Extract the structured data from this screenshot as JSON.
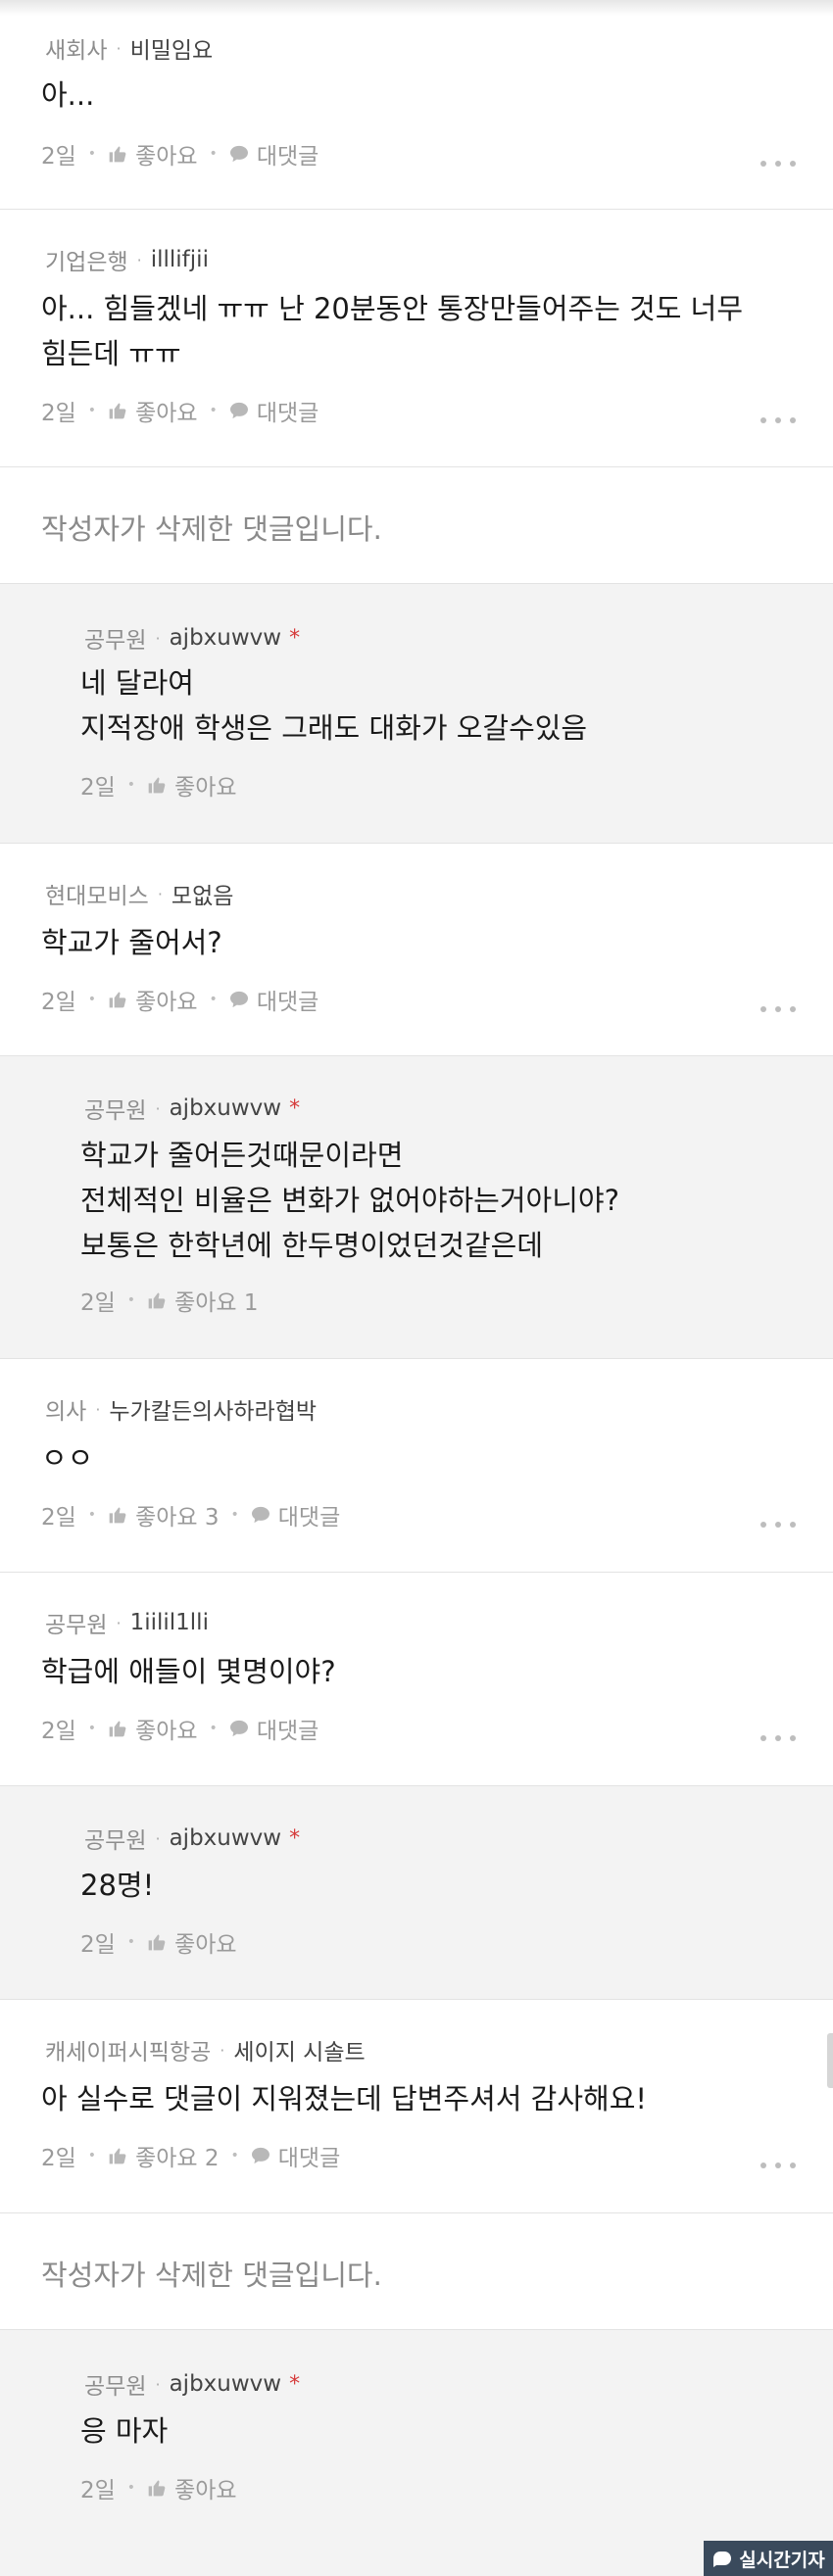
{
  "comments": [
    {
      "company": "새회사",
      "nick": "비밀임요",
      "lines": [
        "아..."
      ],
      "time": "2일",
      "like": "좋아요",
      "reply": "대댓글"
    },
    {
      "company": "기업은행",
      "nick": "illlifjii",
      "lines": [
        "아... 힘들겠네 ㅠㅠ 난 20분동안 통장만들어주는 것도 너무",
        "힘든데 ㅠㅠ"
      ],
      "time": "2일",
      "like": "좋아요",
      "reply": "대댓글"
    },
    {
      "deleted": "작성자가 삭제한 댓글입니다."
    },
    {
      "company": "공무원",
      "nick": "ajbxuwvw",
      "star": "*",
      "lines": [
        "네 달라여",
        "지적장애 학생은 그래도 대화가 오갈수있음"
      ],
      "time": "2일",
      "like": "좋아요"
    },
    {
      "company": "현대모비스",
      "nick": "모없음",
      "lines": [
        "학교가 줄어서?"
      ],
      "time": "2일",
      "like": "좋아요",
      "reply": "대댓글"
    },
    {
      "company": "공무원",
      "nick": "ajbxuwvw",
      "star": "*",
      "lines": [
        "학교가 줄어든것때문이라면",
        "전체적인 비율은 변화가 없어야하는거아니야?",
        "보통은 한학년에 한두명이었던것같은데"
      ],
      "time": "2일",
      "like": "좋아요 1"
    },
    {
      "company": "의사",
      "nick": "누가칼든의사하라협박",
      "lines": [
        "ㅇㅇ"
      ],
      "time": "2일",
      "like": "좋아요 3",
      "reply": "대댓글"
    },
    {
      "company": "공무원",
      "nick": "1iilil1lli",
      "lines": [
        "학급에 애들이 몇명이야?"
      ],
      "time": "2일",
      "like": "좋아요",
      "reply": "대댓글"
    },
    {
      "company": "공무원",
      "nick": "ajbxuwvw",
      "star": "*",
      "lines": [
        "28명!"
      ],
      "time": "2일",
      "like": "좋아요"
    },
    {
      "company": "캐세이퍼시픽항공",
      "nick": "세이지 시솔트",
      "lines": [
        "아 실수로 댓글이 지워졌는데 답변주셔서 감사해요!"
      ],
      "time": "2일",
      "like": "좋아요 2",
      "reply": "대댓글"
    },
    {
      "deleted": "작성자가 삭제한 댓글입니다."
    },
    {
      "company": "공무원",
      "nick": "ajbxuwvw",
      "star": "*",
      "lines": [
        "응 마자"
      ],
      "time": "2일",
      "like": "좋아요"
    }
  ],
  "watermark": "실시간기자",
  "icons": {
    "like": "thumbs-up-icon",
    "reply": "speech-bubble-icon",
    "more": "more-dots-icon"
  },
  "colors": {
    "reply_bg": "#f3f3f3",
    "star": "#d63a3a"
  }
}
